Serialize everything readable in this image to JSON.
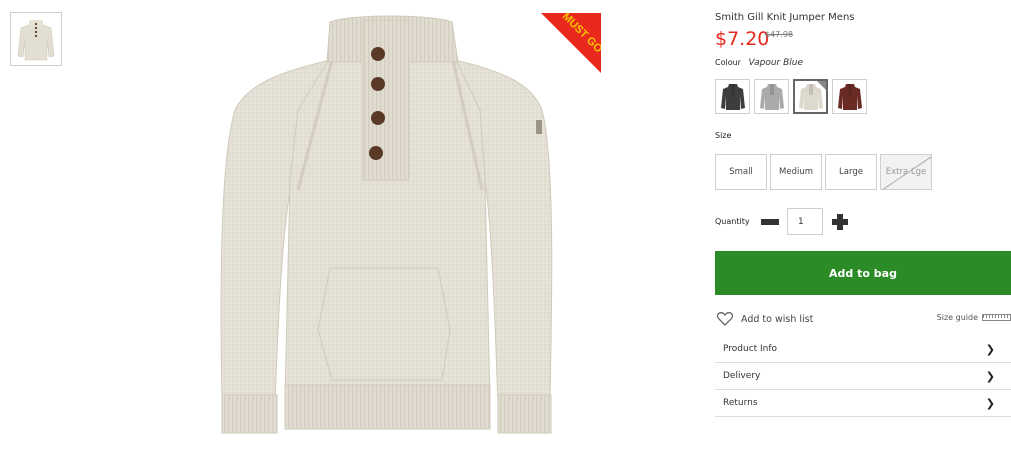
{
  "product": {
    "title": "Smith Gill Knit Jumper Mens",
    "price": "$7.20",
    "old_price": "$47.98",
    "badge_text": "MUST GO",
    "badge_color": "#e8291c",
    "image_alt_icon": "jumper-image"
  },
  "colour": {
    "label": "Colour",
    "selected": "Vapour Blue",
    "options": [
      {
        "name": "charcoal",
        "color": "#3d3d3f"
      },
      {
        "name": "grey",
        "color": "#a9aaac"
      },
      {
        "name": "cream",
        "color": "#ddd9cc"
      },
      {
        "name": "burgundy",
        "color": "#6a2b24"
      }
    ],
    "selected_index": 2
  },
  "size": {
    "label": "Size",
    "options": [
      {
        "label": "Small",
        "available": true
      },
      {
        "label": "Medium",
        "available": true
      },
      {
        "label": "Large",
        "available": true
      },
      {
        "label": "Extra Lge",
        "available": false
      }
    ]
  },
  "quantity": {
    "label": "Quantity",
    "value": "1"
  },
  "actions": {
    "add_to_bag": "Add to bag",
    "add_to_bag_color": "#2b8b26",
    "wish_list": "Add to wish list",
    "size_guide": "Size guide"
  },
  "accordion": [
    {
      "label": "Product Info"
    },
    {
      "label": "Delivery"
    },
    {
      "label": "Returns"
    }
  ]
}
